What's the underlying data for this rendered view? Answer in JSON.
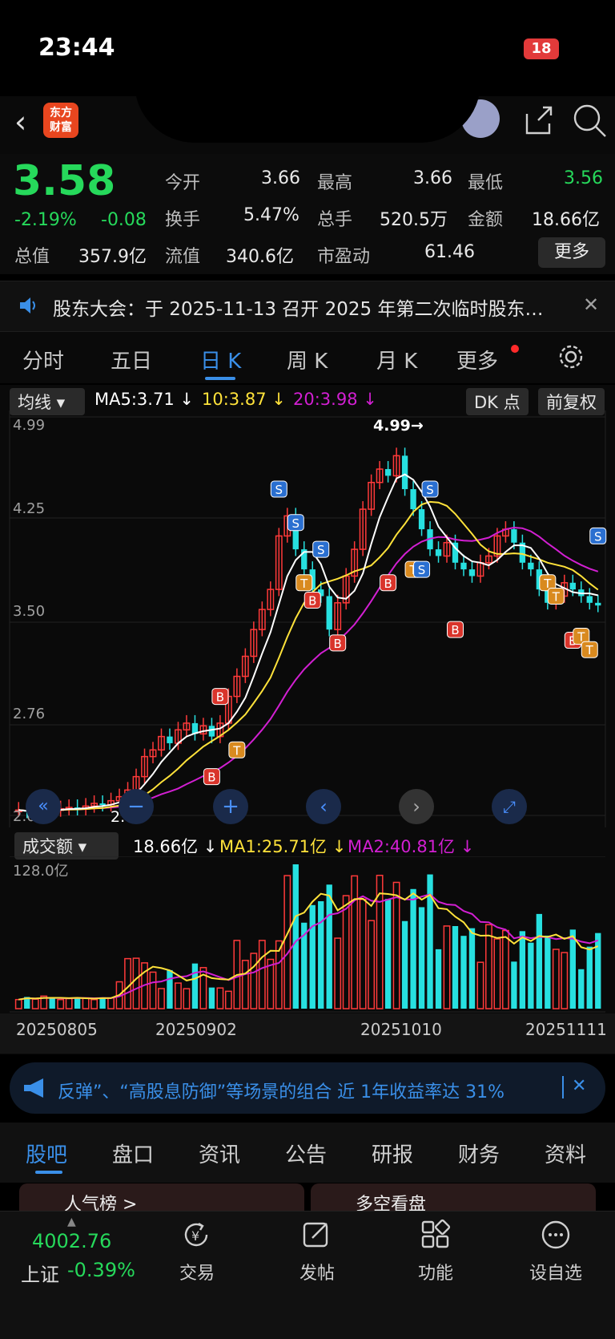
{
  "status": {
    "time": "23:44",
    "battery": "18"
  },
  "stock": {
    "price": "3.58",
    "change_pct": "-2.19%",
    "change": "-0.08"
  },
  "quote_rows": [
    [
      {
        "label": "今开",
        "value": "3.66"
      },
      {
        "label": "最高",
        "value": "3.66"
      },
      {
        "label": "最低",
        "value": "3.56"
      }
    ],
    [
      {
        "label": "换手",
        "value": "5.47%"
      },
      {
        "label": "总手",
        "value": "520.5万"
      },
      {
        "label": "金额",
        "value": "18.66亿"
      }
    ],
    [
      {
        "label": "总值",
        "value": "357.9亿"
      },
      {
        "label": "流值",
        "value": "340.6亿"
      },
      {
        "label": "市盈动",
        "value": "61.46"
      }
    ]
  ],
  "more_button": "更多",
  "notice": "股东大会：于 2025-11-13 召开 2025 年第二次临时股东…",
  "tabs": [
    "分时",
    "五日",
    "日 K",
    "周 K",
    "月 K",
    "更多"
  ],
  "indicator": {
    "type": "均线",
    "ma5": "MA5:3.71 ↓",
    "ma10": "10:3.87 ↓",
    "ma20": "20:3.98 ↓",
    "dk": "DK 点",
    "fq": "前复权"
  },
  "price_axis": [
    "4.99",
    "4.25",
    "3.50",
    "2.76",
    "2.01"
  ],
  "annotations": {
    "high": "4.99→",
    "low": "2.01"
  },
  "volume": {
    "type": "成交额",
    "amount": "18.66亿 ↓",
    "ma1": "MA1:25.71亿 ↓",
    "ma2": "MA2:40.81亿 ↓",
    "max": "128.0亿"
  },
  "dates": [
    "20250805",
    "20250902",
    "20251010",
    "20251111"
  ],
  "banner": "反弹”、“高股息防御”等场景的组合 近 1年收益率达 31%",
  "bottom_tabs": [
    "股吧",
    "盘口",
    "资讯",
    "公告",
    "研报",
    "财务",
    "资料"
  ],
  "cards": [
    "人气榜 >",
    "多空看盘"
  ],
  "dock": {
    "index_value": "4002.76",
    "index_name": "上证",
    "index_change": "-0.39%",
    "items": [
      "交易",
      "发帖",
      "功能",
      "设自选"
    ]
  },
  "colors": {
    "up": "#ff3a3a",
    "down": "#27e0e0",
    "ma5": "#ffffff",
    "ma10": "#ffe23a",
    "ma20": "#d21fd2",
    "green": "#26d95b"
  },
  "chart_data": {
    "type": "candlestick",
    "ylim": [
      2.01,
      4.99
    ],
    "ma_values": {
      "MA5": 3.71,
      "MA10": 3.87,
      "MA20": 3.98
    },
    "volume_max": 128.0
  }
}
